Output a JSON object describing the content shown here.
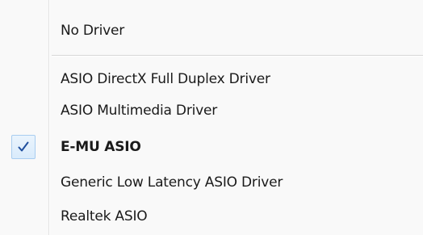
{
  "menu": {
    "items": [
      {
        "label": "No Driver",
        "checked": false,
        "bold": false
      },
      {
        "label": "ASIO DirectX Full Duplex Driver",
        "checked": false,
        "bold": false
      },
      {
        "label": "ASIO Multimedia Driver",
        "checked": false,
        "bold": false
      },
      {
        "label": "E-MU ASIO",
        "checked": true,
        "bold": true
      },
      {
        "label": "Generic Low Latency ASIO Driver",
        "checked": false,
        "bold": false
      },
      {
        "label": "Realtek ASIO",
        "checked": false,
        "bold": false
      }
    ],
    "colors": {
      "background": "#f9f9f9",
      "check": "#1f4f9e",
      "check_highlight": "#d9ebfb"
    }
  }
}
